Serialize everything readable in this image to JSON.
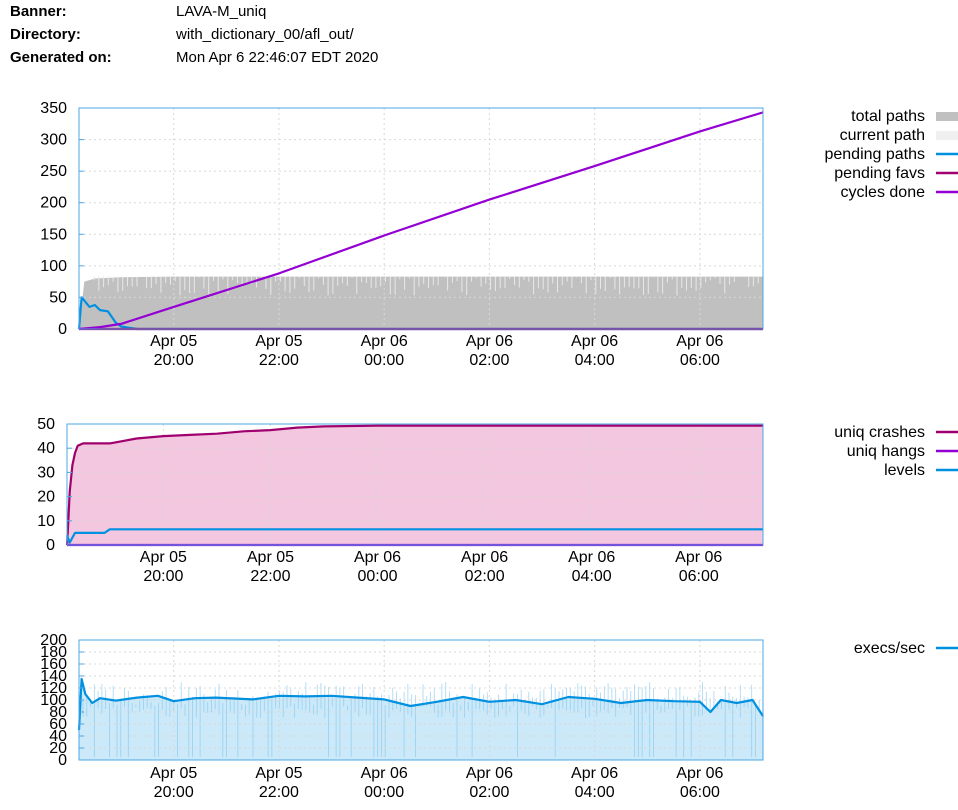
{
  "header": {
    "banner_label": "Banner:",
    "banner_value": "LAVA-M_uniq",
    "directory_label": "Directory:",
    "directory_value": "with_dictionary_00/afl_out/",
    "generated_label": "Generated on:",
    "generated_value": "Mon Apr 6 22:46:07 EDT 2020"
  },
  "chart_data": [
    {
      "type": "area",
      "title": "",
      "x_tick_labels": [
        [
          "Apr 05",
          "20:00"
        ],
        [
          "Apr 05",
          "22:00"
        ],
        [
          "Apr 06",
          "00:00"
        ],
        [
          "Apr 06",
          "02:00"
        ],
        [
          "Apr 06",
          "04:00"
        ],
        [
          "Apr 06",
          "06:00"
        ]
      ],
      "x_range_hours": [
        18.2,
        31.2
      ],
      "x_tick_hours": [
        20,
        22,
        24,
        26,
        28,
        30
      ],
      "ylim": [
        0,
        350
      ],
      "y_ticks": [
        0,
        50,
        100,
        150,
        200,
        250,
        300,
        350
      ],
      "grid": true,
      "legend_placement": "right",
      "series": [
        {
          "name": "total paths",
          "color": "#c0c0c0",
          "style": "filled",
          "x": [
            18.2,
            18.3,
            18.5,
            19.0,
            20.0,
            31.2
          ],
          "y": [
            0,
            75,
            80,
            82,
            83,
            83
          ]
        },
        {
          "name": "current path",
          "color": "#f0f0f0",
          "style": "filled",
          "x": [
            18.2,
            31.2
          ],
          "y": [
            0,
            0
          ]
        },
        {
          "name": "pending paths",
          "color": "#0090e0",
          "style": "line",
          "x": [
            18.2,
            18.25,
            18.3,
            18.4,
            18.5,
            18.6,
            18.75,
            18.9,
            19.0,
            19.3,
            31.2
          ],
          "y": [
            0,
            50,
            45,
            35,
            38,
            30,
            28,
            10,
            4,
            0,
            0
          ]
        },
        {
          "name": "pending favs",
          "color": "#a0006d",
          "style": "line",
          "x": [
            18.2,
            31.2
          ],
          "y": [
            0,
            0
          ]
        },
        {
          "name": "cycles done",
          "color": "#9400d3",
          "style": "line",
          "x": [
            18.2,
            18.6,
            19.0,
            20.0,
            22.0,
            24.0,
            26.0,
            28.0,
            30.0,
            31.2
          ],
          "y": [
            0,
            3,
            8,
            35,
            88,
            148,
            205,
            258,
            313,
            343
          ]
        }
      ]
    },
    {
      "type": "area",
      "title": "",
      "x_tick_labels": [
        [
          "Apr 05",
          "20:00"
        ],
        [
          "Apr 05",
          "22:00"
        ],
        [
          "Apr 06",
          "00:00"
        ],
        [
          "Apr 06",
          "02:00"
        ],
        [
          "Apr 06",
          "04:00"
        ],
        [
          "Apr 06",
          "06:00"
        ]
      ],
      "x_range_hours": [
        18.2,
        31.2
      ],
      "x_tick_hours": [
        20,
        22,
        24,
        26,
        28,
        30
      ],
      "ylim": [
        0,
        50
      ],
      "y_ticks": [
        0,
        10,
        20,
        30,
        40,
        50
      ],
      "grid": true,
      "legend_placement": "right",
      "series": [
        {
          "name": "uniq crashes",
          "color": "#a0006d",
          "style": "line-filled",
          "x": [
            18.2,
            18.22,
            18.25,
            18.3,
            18.35,
            18.4,
            18.5,
            19.0,
            19.5,
            20.0,
            20.5,
            21.0,
            21.5,
            22.0,
            22.5,
            23.0,
            24.0,
            31.2
          ],
          "y": [
            0,
            8,
            22,
            33,
            38,
            41,
            42,
            42,
            44,
            45,
            45.5,
            46,
            47,
            47.5,
            48.5,
            49,
            49.3,
            49.3
          ]
        },
        {
          "name": "uniq hangs",
          "color": "#9400d3",
          "style": "line",
          "x": [
            18.2,
            31.2
          ],
          "y": [
            0,
            0
          ]
        },
        {
          "name": "levels",
          "color": "#0090e0",
          "style": "line",
          "x": [
            18.2,
            18.25,
            18.35,
            18.9,
            19.0,
            31.2
          ],
          "y": [
            4,
            1,
            5,
            5,
            6.5,
            6.5
          ]
        }
      ]
    },
    {
      "type": "area",
      "title": "",
      "x_tick_labels": [
        [
          "Apr 05",
          "20:00"
        ],
        [
          "Apr 05",
          "22:00"
        ],
        [
          "Apr 06",
          "00:00"
        ],
        [
          "Apr 06",
          "02:00"
        ],
        [
          "Apr 06",
          "04:00"
        ],
        [
          "Apr 06",
          "06:00"
        ]
      ],
      "x_range_hours": [
        18.2,
        31.2
      ],
      "x_tick_hours": [
        20,
        22,
        24,
        26,
        28,
        30
      ],
      "ylim": [
        0,
        200
      ],
      "y_ticks": [
        0,
        20,
        40,
        60,
        80,
        100,
        120,
        140,
        160,
        180,
        200
      ],
      "grid": true,
      "legend_placement": "right",
      "series": [
        {
          "name": "execs/sec",
          "color": "#0090e0",
          "style": "line-filled",
          "x": [
            18.2,
            18.25,
            18.32,
            18.45,
            18.6,
            18.9,
            19.3,
            19.7,
            20.0,
            20.4,
            20.8,
            21.5,
            22.0,
            22.5,
            23.0,
            23.5,
            24.0,
            24.5,
            25.0,
            25.5,
            26.0,
            26.5,
            27.0,
            27.5,
            28.0,
            28.5,
            29.0,
            29.5,
            30.0,
            30.2,
            30.4,
            30.7,
            31.0,
            31.2
          ],
          "y": [
            50,
            135,
            110,
            95,
            103,
            99,
            104,
            107,
            98,
            103,
            104,
            101,
            107,
            106,
            107,
            104,
            101,
            90,
            97,
            105,
            97,
            100,
            93,
            105,
            102,
            95,
            100,
            98,
            97,
            80,
            100,
            95,
            100,
            73
          ]
        }
      ]
    }
  ]
}
